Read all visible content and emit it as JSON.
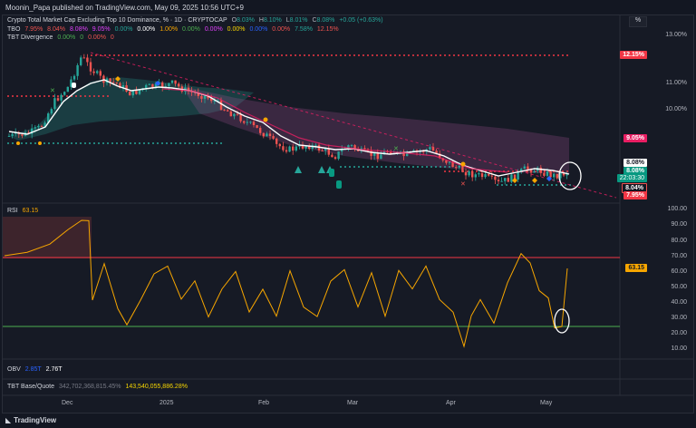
{
  "header": {
    "published": "Moonin_Papa published on TradingView.com, May 09, 2025 10:56 UTC+9"
  },
  "symbol": {
    "title": "Crypto Total Market Cap Excluding Top 10 Dominance, % · 1D · CRYPTOCAP",
    "o_label": "O",
    "o": "8.03%",
    "h_label": "H",
    "h": "8.10%",
    "l_label": "L",
    "l": "8.01%",
    "c_label": "C",
    "c": "8.08%",
    "change": "+0.05 (+0.63%)"
  },
  "tbo": {
    "name": "TBO",
    "values": [
      "7.95%",
      "8.04%",
      "8.08%",
      "9.05%",
      "0.00%",
      "0.00%",
      "1.00%",
      "0.00%",
      "0.00%",
      "0.00%",
      "0.00%",
      "0.00%",
      "7.58%",
      "12.15%"
    ]
  },
  "tbt_div": {
    "name": "TBT Divergence",
    "values": [
      "0.00%",
      "0",
      "0.00%",
      "0"
    ]
  },
  "price_axis": [
    "13.00%",
    "12.00%",
    "11.00%",
    "10.00%",
    "9.00%"
  ],
  "price_badges": {
    "top_res": "12.15%",
    "mid": "9.05%",
    "close_a": "8.08%",
    "close_b": "8.08%",
    "countdown": "22:03:30",
    "low_a": "8.04%",
    "low_b": "7.95%"
  },
  "pct_button": "%",
  "rsi": {
    "name": "RSI",
    "value": "63.15",
    "axis": [
      "100.00",
      "90.00",
      "80.00",
      "70.00",
      "60.00",
      "50.00",
      "40.00",
      "30.00",
      "20.00",
      "10.00"
    ],
    "badge": "63.15"
  },
  "obv": {
    "name": "OBV",
    "v1": "2.85T",
    "v2": "2.76T"
  },
  "tbt_base": {
    "name": "TBT Base/Quote",
    "v1": "342,702,368,815.45%",
    "v2": "143,540,055,886.28%"
  },
  "time_axis": [
    "Dec",
    "2025",
    "Feb",
    "Mar",
    "Apr",
    "May"
  ],
  "footer": {
    "brand": "TradingView"
  },
  "colors": {
    "bg": "#131722",
    "pane": "#161a25",
    "up": "#26a69a",
    "down": "#ef5350",
    "rsi_line": "#f7a600",
    "red_badge": "#f23645",
    "pink_badge": "#e91e63",
    "green_badge": "#089981"
  }
}
